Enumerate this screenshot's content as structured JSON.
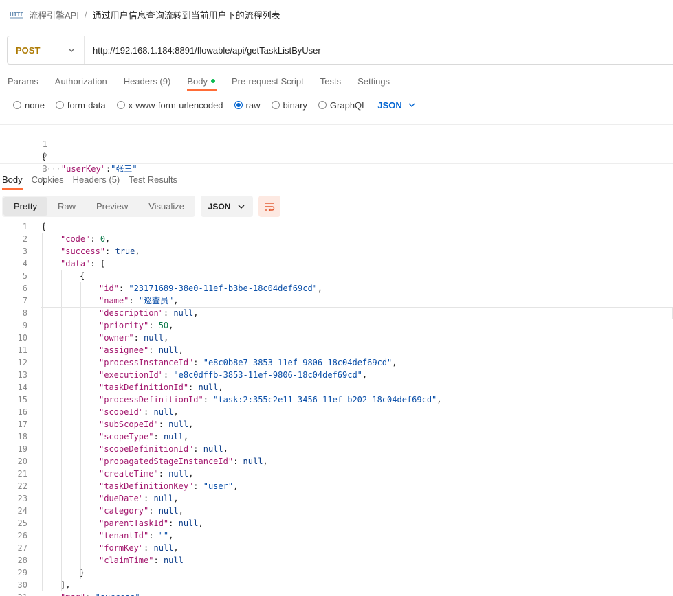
{
  "breadcrumb": {
    "icon": "http-icon",
    "parent": "流程引擎API",
    "separator": "/",
    "title": "通过用户信息查询流转到当前用户下的流程列表"
  },
  "request": {
    "method": "POST",
    "url": "http://192.168.1.184:8891/flowable/api/getTaskListByUser"
  },
  "request_tabs": [
    {
      "label": "Params"
    },
    {
      "label": "Authorization"
    },
    {
      "label": "Headers (9)"
    },
    {
      "label": "Body"
    },
    {
      "label": "Pre-request Script"
    },
    {
      "label": "Tests"
    },
    {
      "label": "Settings"
    }
  ],
  "body_types": [
    {
      "label": "none",
      "selected": false
    },
    {
      "label": "form-data",
      "selected": false
    },
    {
      "label": "x-www-form-urlencoded",
      "selected": false
    },
    {
      "label": "raw",
      "selected": true
    },
    {
      "label": "binary",
      "selected": false
    },
    {
      "label": "GraphQL",
      "selected": false
    }
  ],
  "body_format": "JSON",
  "request_body_lines": [
    {
      "n": "1",
      "text": "{"
    },
    {
      "n": "2",
      "key": "\"userKey\"",
      "value": "\"张三\""
    },
    {
      "n": "3",
      "text": "}"
    }
  ],
  "response_tabs": [
    {
      "label": "Body"
    },
    {
      "label": "Cookies"
    },
    {
      "label": "Headers (5)"
    },
    {
      "label": "Test Results"
    }
  ],
  "view_modes": [
    {
      "label": "Pretty"
    },
    {
      "label": "Raw"
    },
    {
      "label": "Preview"
    },
    {
      "label": "Visualize"
    }
  ],
  "response_format": "JSON",
  "response_lines": [
    {
      "n": "1",
      "text": "{"
    },
    {
      "n": "2",
      "key": "\"code\"",
      "value": "0",
      "type": "num",
      "comma": ","
    },
    {
      "n": "3",
      "key": "\"success\"",
      "value": "true",
      "type": "kw",
      "comma": ","
    },
    {
      "n": "4",
      "key": "\"data\"",
      "value": "[",
      "type": "plain",
      "comma": ""
    },
    {
      "n": "5",
      "text": "{"
    },
    {
      "n": "6",
      "key": "\"id\"",
      "value": "\"23171689-38e0-11ef-b3be-18c04def69cd\"",
      "type": "str",
      "comma": ","
    },
    {
      "n": "7",
      "key": "\"name\"",
      "value": "\"巡查员\"",
      "type": "str",
      "comma": ","
    },
    {
      "n": "8",
      "key": "\"description\"",
      "value": "null",
      "type": "kw",
      "comma": ","
    },
    {
      "n": "9",
      "key": "\"priority\"",
      "value": "50",
      "type": "num",
      "comma": ","
    },
    {
      "n": "10",
      "key": "\"owner\"",
      "value": "null",
      "type": "kw",
      "comma": ","
    },
    {
      "n": "11",
      "key": "\"assignee\"",
      "value": "null",
      "type": "kw",
      "comma": ","
    },
    {
      "n": "12",
      "key": "\"processInstanceId\"",
      "value": "\"e8c0b8e7-3853-11ef-9806-18c04def69cd\"",
      "type": "str",
      "comma": ","
    },
    {
      "n": "13",
      "key": "\"executionId\"",
      "value": "\"e8c0dffb-3853-11ef-9806-18c04def69cd\"",
      "type": "str",
      "comma": ","
    },
    {
      "n": "14",
      "key": "\"taskDefinitionId\"",
      "value": "null",
      "type": "kw",
      "comma": ","
    },
    {
      "n": "15",
      "key": "\"processDefinitionId\"",
      "value": "\"task:2:355c2e11-3456-11ef-b202-18c04def69cd\"",
      "type": "str",
      "comma": ","
    },
    {
      "n": "16",
      "key": "\"scopeId\"",
      "value": "null",
      "type": "kw",
      "comma": ","
    },
    {
      "n": "17",
      "key": "\"subScopeId\"",
      "value": "null",
      "type": "kw",
      "comma": ","
    },
    {
      "n": "18",
      "key": "\"scopeType\"",
      "value": "null",
      "type": "kw",
      "comma": ","
    },
    {
      "n": "19",
      "key": "\"scopeDefinitionId\"",
      "value": "null",
      "type": "kw",
      "comma": ","
    },
    {
      "n": "20",
      "key": "\"propagatedStageInstanceId\"",
      "value": "null",
      "type": "kw",
      "comma": ","
    },
    {
      "n": "21",
      "key": "\"createTime\"",
      "value": "null",
      "type": "kw",
      "comma": ","
    },
    {
      "n": "22",
      "key": "\"taskDefinitionKey\"",
      "value": "\"user\"",
      "type": "str",
      "comma": ","
    },
    {
      "n": "23",
      "key": "\"dueDate\"",
      "value": "null",
      "type": "kw",
      "comma": ","
    },
    {
      "n": "24",
      "key": "\"category\"",
      "value": "null",
      "type": "kw",
      "comma": ","
    },
    {
      "n": "25",
      "key": "\"parentTaskId\"",
      "value": "null",
      "type": "kw",
      "comma": ","
    },
    {
      "n": "26",
      "key": "\"tenantId\"",
      "value": "\"\"",
      "type": "str",
      "comma": ","
    },
    {
      "n": "27",
      "key": "\"formKey\"",
      "value": "null",
      "type": "kw",
      "comma": ","
    },
    {
      "n": "28",
      "key": "\"claimTime\"",
      "value": "null",
      "type": "kw",
      "comma": ""
    },
    {
      "n": "29",
      "text": "}"
    },
    {
      "n": "30",
      "text": "],"
    },
    {
      "n": "31",
      "key": "\"msg\"",
      "value": "\"success\"",
      "type": "str",
      "comma": ""
    }
  ]
}
